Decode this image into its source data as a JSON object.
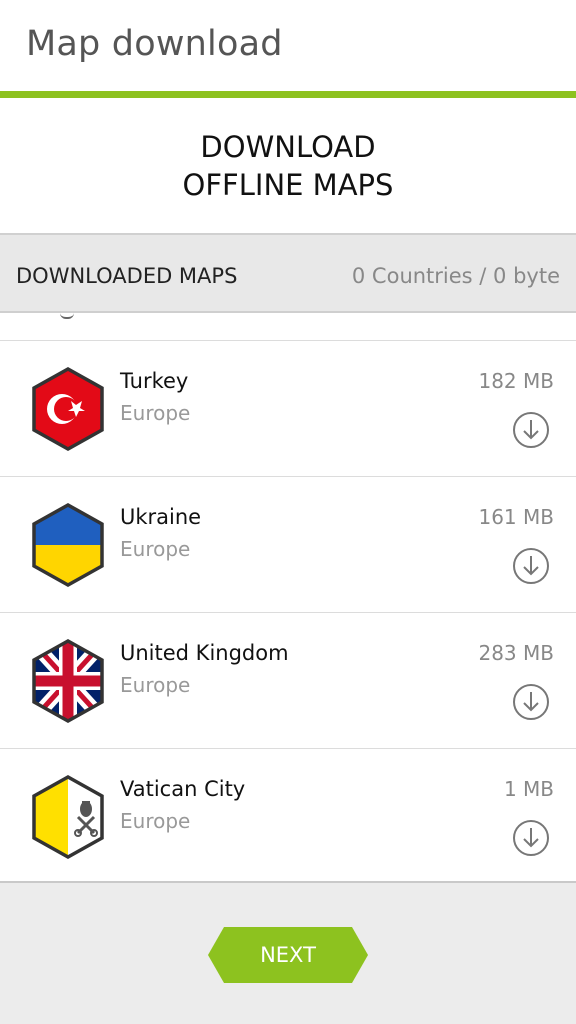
{
  "app_bar": {
    "title": "Map download"
  },
  "accent_color": "#8dc21f",
  "headline": {
    "line1": "DOWNLOAD",
    "line2": "OFFLINE MAPS"
  },
  "downloaded_section": {
    "title": "DOWNLOADED MAPS",
    "summary": "0 Countries / 0 byte"
  },
  "countries": [
    {
      "name": "Turkey",
      "region": "Europe",
      "size": "182 MB",
      "flag_icon": "turkey-flag-icon",
      "action_icon": "download-icon"
    },
    {
      "name": "Ukraine",
      "region": "Europe",
      "size": "161 MB",
      "flag_icon": "ukraine-flag-icon",
      "action_icon": "download-icon"
    },
    {
      "name": "United Kingdom",
      "region": "Europe",
      "size": "283 MB",
      "flag_icon": "uk-flag-icon",
      "action_icon": "download-icon"
    },
    {
      "name": "Vatican City",
      "region": "Europe",
      "size": "1 MB",
      "flag_icon": "vatican-flag-icon",
      "action_icon": "download-icon"
    }
  ],
  "footer": {
    "next_label": "NEXT"
  }
}
